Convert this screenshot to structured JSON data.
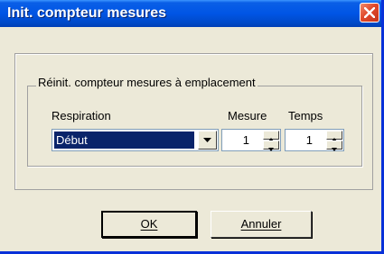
{
  "window": {
    "title": "Init. compteur mesures"
  },
  "group": {
    "caption": "Réinit. compteur mesures à emplacement",
    "labels": {
      "respiration": "Respiration",
      "mesure": "Mesure",
      "temps": "Temps"
    },
    "respiration_value": "Début",
    "mesure_value": "1",
    "temps_value": "1"
  },
  "buttons": {
    "ok": "OK",
    "cancel": "Annuler"
  },
  "icons": {
    "close": "close-icon",
    "dropdown": "chevron-down-icon",
    "spin_up": "arrow-up-icon",
    "spin_down": "arrow-down-icon"
  },
  "colors": {
    "titlebar": "#0055e5",
    "dialog_bg": "#ece9d8",
    "selection": "#0a246a",
    "close": "#e0492a"
  }
}
